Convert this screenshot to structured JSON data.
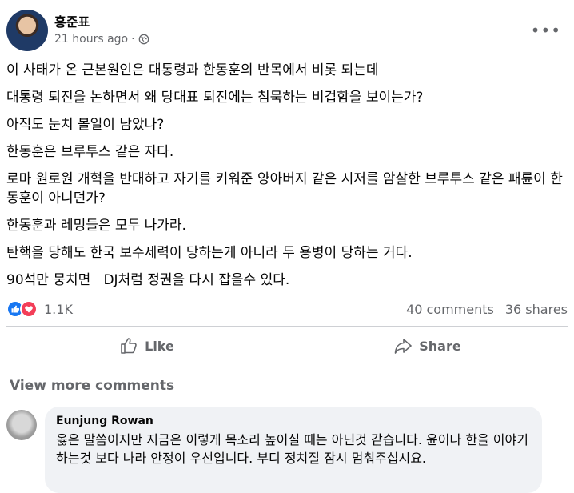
{
  "post": {
    "author": "홍준표",
    "time": "21 hours ago",
    "lines": [
      "이 사태가 온 근본원인은 대통령과 한동훈의 반목에서 비롯 되는데",
      "대통령 퇴진을 논하면서 왜 당대표 퇴진에는 침묵하는 비겁함을 보이는가?",
      "아직도 눈치 볼일이 남았나?",
      "한동훈은 브루투스 같은 자다.",
      "로마 원로원 개혁을 반대하고 자기를 키워준 양아버지 같은 시저를 암살한 브루투스 같은 패륜이 한동훈이 아니던가?",
      "한동훈과 레밍들은 모두 나가라.",
      "탄핵을 당해도 한국 보수세력이 당하는게 아니라 두 용병이 당하는 거다.",
      "90석만 뭉치면   DJ처럼 정권을 다시 잡을수 있다."
    ]
  },
  "reactions": {
    "count": "1.1K",
    "comments": "40 comments",
    "shares": "36 shares"
  },
  "actions": {
    "like": "Like",
    "share": "Share"
  },
  "view_more": "View more comments",
  "comment": {
    "author": "Eunjung Rowan",
    "text": "옳은 말씀이지만 지금은 이렇게 목소리 높이실 때는 아닌것 같습니다. 윤이나 한을 이야기 하는것 보다 나라 안정이 우선입니다. 부디 정치질 잠시 멈춰주십시요."
  },
  "colors": {
    "like_blue": "#1877f2",
    "love_red": "#f33e58",
    "secondary_text": "#65676b",
    "bubble_bg": "#f0f2f5"
  }
}
